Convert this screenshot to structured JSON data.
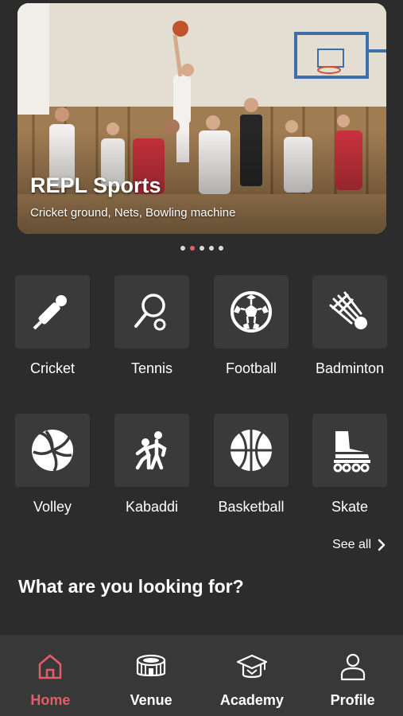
{
  "banner": {
    "title": "REPL Sports",
    "subtitle": "Cricket ground, Nets, Bowling machine",
    "slide_count": 5,
    "active_slide": 2
  },
  "sports": [
    {
      "label": "Cricket",
      "icon": "cricket-bat-icon"
    },
    {
      "label": "Tennis",
      "icon": "tennis-racket-icon"
    },
    {
      "label": "Football",
      "icon": "football-icon"
    },
    {
      "label": "Badminton",
      "icon": "shuttlecock-icon"
    },
    {
      "label": "Volley",
      "icon": "volleyball-icon"
    },
    {
      "label": "Kabaddi",
      "icon": "kabaddi-icon"
    },
    {
      "label": "Basketball",
      "icon": "basketball-icon"
    },
    {
      "label": "Skate",
      "icon": "roller-skate-icon"
    }
  ],
  "see_all": "See all",
  "section_heading": "What are you looking for?",
  "nav": {
    "items": [
      {
        "label": "Home",
        "icon": "home-icon",
        "active": true
      },
      {
        "label": "Venue",
        "icon": "stadium-icon",
        "active": false
      },
      {
        "label": "Academy",
        "icon": "graduation-cap-icon",
        "active": false
      },
      {
        "label": "Profile",
        "icon": "user-icon",
        "active": false
      }
    ]
  },
  "colors": {
    "background": "#2c2c2c",
    "tile": "#3a3a3a",
    "nav_background": "#383838",
    "accent": "#e35d6a",
    "text": "#ffffff"
  }
}
